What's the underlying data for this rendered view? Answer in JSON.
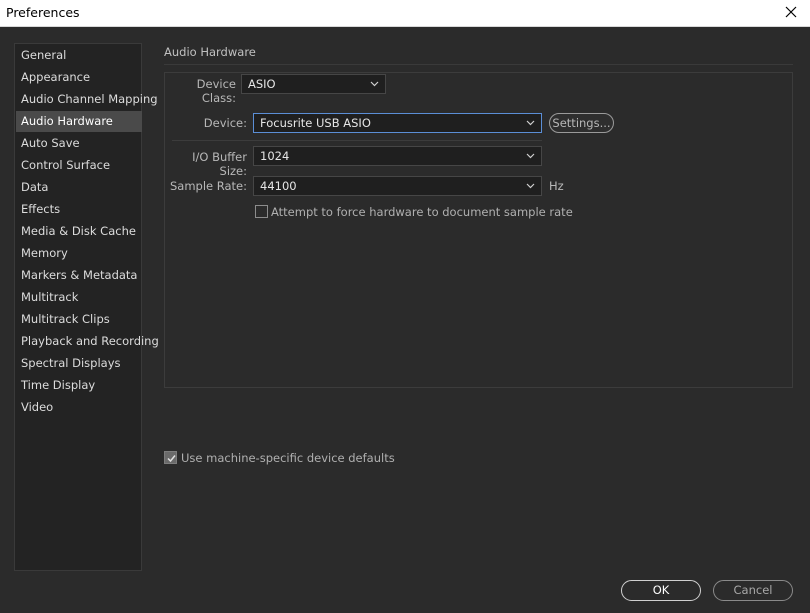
{
  "window": {
    "title": "Preferences",
    "close_icon": "close-icon"
  },
  "sidebar": {
    "selected": "Audio Hardware",
    "items": [
      {
        "label": "General"
      },
      {
        "label": "Appearance"
      },
      {
        "label": "Audio Channel Mapping"
      },
      {
        "label": "Audio Hardware"
      },
      {
        "label": "Auto Save"
      },
      {
        "label": "Control Surface"
      },
      {
        "label": "Data"
      },
      {
        "label": "Effects"
      },
      {
        "label": "Media & Disk Cache"
      },
      {
        "label": "Memory"
      },
      {
        "label": "Markers & Metadata"
      },
      {
        "label": "Multitrack"
      },
      {
        "label": "Multitrack Clips"
      },
      {
        "label": "Playback and Recording"
      },
      {
        "label": "Spectral Displays"
      },
      {
        "label": "Time Display"
      },
      {
        "label": "Video"
      }
    ]
  },
  "main": {
    "section_title": "Audio Hardware",
    "device_class": {
      "label": "Device Class:",
      "value": "ASIO"
    },
    "device": {
      "label": "Device:",
      "value": "Focusrite USB ASIO"
    },
    "settings_button": "Settings...",
    "buffer_size": {
      "label": "I/O Buffer Size:",
      "value": "1024"
    },
    "sample_rate": {
      "label": "Sample Rate:",
      "value": "44100",
      "unit": "Hz"
    },
    "force_sample_rate": {
      "label": "Attempt to force hardware to document sample rate",
      "checked": false
    },
    "machine_defaults": {
      "label": "Use machine-specific device defaults",
      "checked": true
    }
  },
  "footer": {
    "ok_label": "OK",
    "cancel_label": "Cancel"
  },
  "colors": {
    "background": "#2b2b2b",
    "selected_item": "#4a4a4a",
    "focus_border": "#5b8ed6"
  }
}
